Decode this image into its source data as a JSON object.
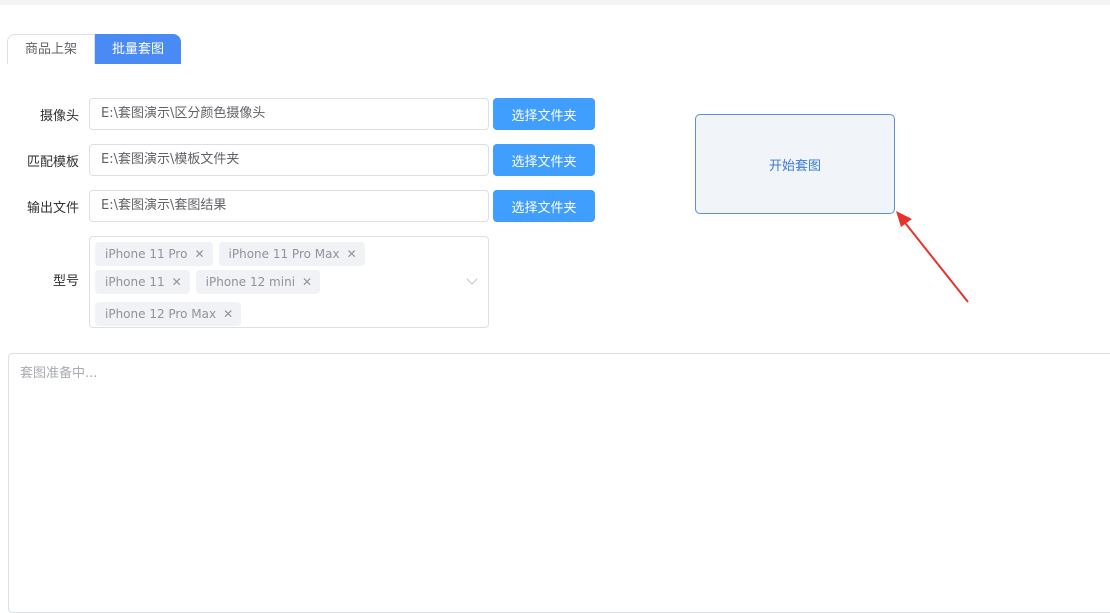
{
  "tabs": [
    {
      "label": "商品上架",
      "active": false
    },
    {
      "label": "批量套图",
      "active": true
    }
  ],
  "form": {
    "camera": {
      "label": "摄像头",
      "value": "E:\\套图演示\\区分颜色摄像头",
      "button": "选择文件夹"
    },
    "template": {
      "label": "匹配模板",
      "value": "E:\\套图演示\\模板文件夹",
      "button": "选择文件夹"
    },
    "output": {
      "label": "输出文件",
      "value": "E:\\套图演示\\套图结果",
      "button": "选择文件夹"
    },
    "model": {
      "label": "型号",
      "tags": [
        "iPhone 11 Pro",
        "iPhone 11 Pro Max",
        "iPhone 11",
        "iPhone 12 mini",
        "iPhone 12 Pro Max"
      ]
    }
  },
  "start_button": "开始套图",
  "log": {
    "placeholder": "套图准备中..."
  },
  "colors": {
    "accent": "#409eff",
    "tab_active": "#4a8af4",
    "annotation_arrow": "#e8322c"
  }
}
